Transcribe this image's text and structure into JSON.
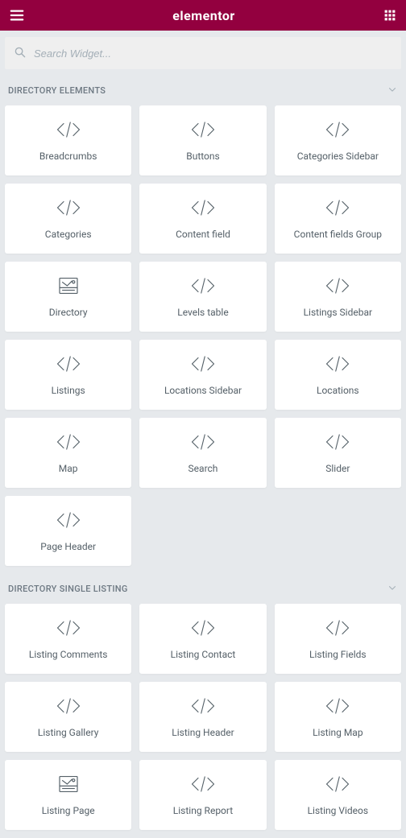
{
  "header": {
    "title": "elementor"
  },
  "search": {
    "placeholder": "Search Widget..."
  },
  "sections": [
    {
      "title": "DIRECTORY ELEMENTS",
      "widgets": [
        {
          "label": "Breadcrumbs",
          "icon": "code"
        },
        {
          "label": "Buttons",
          "icon": "code"
        },
        {
          "label": "Categories Sidebar",
          "icon": "code"
        },
        {
          "label": "Categories",
          "icon": "code"
        },
        {
          "label": "Content field",
          "icon": "code"
        },
        {
          "label": "Content fields Group",
          "icon": "code"
        },
        {
          "label": "Directory",
          "icon": "directory"
        },
        {
          "label": "Levels table",
          "icon": "code"
        },
        {
          "label": "Listings Sidebar",
          "icon": "code"
        },
        {
          "label": "Listings",
          "icon": "code"
        },
        {
          "label": "Locations Sidebar",
          "icon": "code"
        },
        {
          "label": "Locations",
          "icon": "code"
        },
        {
          "label": "Map",
          "icon": "code"
        },
        {
          "label": "Search",
          "icon": "code"
        },
        {
          "label": "Slider",
          "icon": "code"
        },
        {
          "label": "Page Header",
          "icon": "code"
        }
      ]
    },
    {
      "title": "DIRECTORY SINGLE LISTING",
      "widgets": [
        {
          "label": "Listing Comments",
          "icon": "code"
        },
        {
          "label": "Listing Contact",
          "icon": "code"
        },
        {
          "label": "Listing Fields",
          "icon": "code"
        },
        {
          "label": "Listing Gallery",
          "icon": "code"
        },
        {
          "label": "Listing Header",
          "icon": "code"
        },
        {
          "label": "Listing Map",
          "icon": "code"
        },
        {
          "label": "Listing Page",
          "icon": "directory"
        },
        {
          "label": "Listing Report",
          "icon": "code"
        },
        {
          "label": "Listing Videos",
          "icon": "code"
        }
      ]
    }
  ]
}
